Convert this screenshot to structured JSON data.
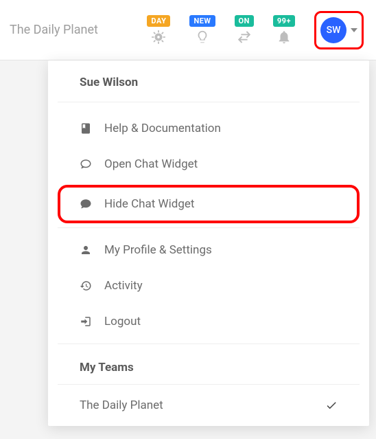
{
  "brand": "The Daily Planet",
  "badges": {
    "day": "DAY",
    "new": "NEW",
    "on": "ON",
    "count": "99+"
  },
  "avatar_initials": "SW",
  "dropdown": {
    "user_name": "Sue Wilson",
    "items": {
      "help": "Help & Documentation",
      "open_chat": "Open Chat Widget",
      "hide_chat": "Hide Chat Widget",
      "profile": "My Profile & Settings",
      "activity": "Activity",
      "logout": "Logout"
    },
    "teams_header": "My Teams",
    "teams": [
      {
        "name": "The Daily Planet",
        "active": true
      }
    ]
  }
}
